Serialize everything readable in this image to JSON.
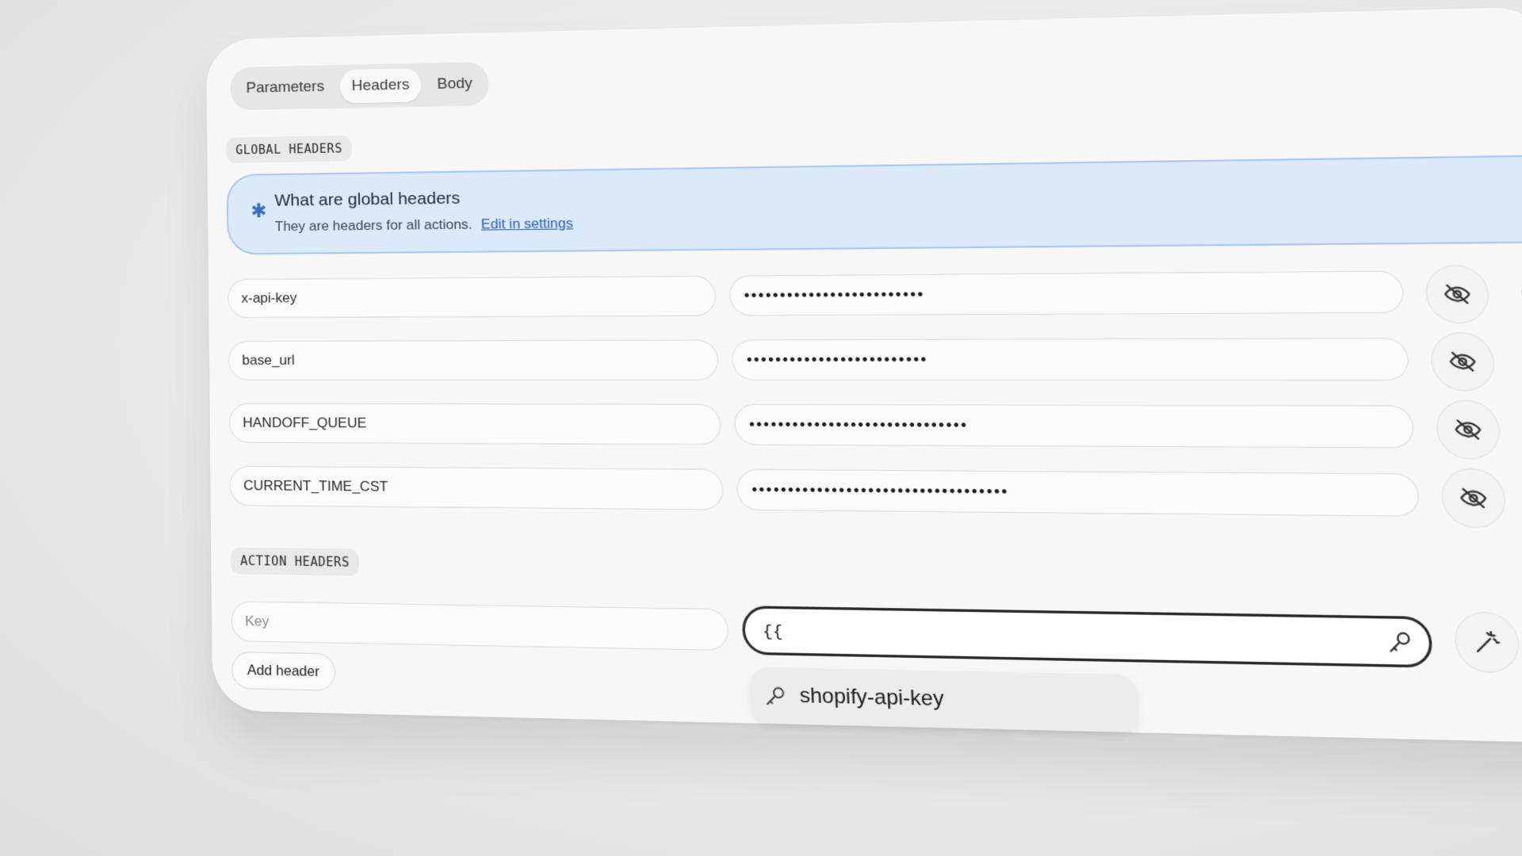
{
  "tabs": [
    {
      "label": "Parameters",
      "active": false
    },
    {
      "label": "Headers",
      "active": true
    },
    {
      "label": "Body",
      "active": false
    }
  ],
  "global_headers": {
    "section_label": "GLOBAL HEADERS",
    "info": {
      "icon": "asterisk-icon",
      "title": "What are global headers",
      "text": "They are headers for all actions.",
      "link": "Edit in settings"
    },
    "rows": [
      {
        "key": "x-api-key",
        "value": "•••••••••••••••••••••••••"
      },
      {
        "key": "base_url",
        "value": "•••••••••••••••••••••••••"
      },
      {
        "key": "HANDOFF_QUEUE",
        "value": "••••••••••••••••••••••••••••••"
      },
      {
        "key": "CURRENT_TIME_CST",
        "value": "•••••••••••••••••••••••••••••••••••"
      }
    ]
  },
  "action_headers": {
    "section_label": "ACTION HEADERS",
    "key_placeholder": "Key",
    "value_text": "{{",
    "add_button": "Add header",
    "suggestion": "shopify-api-key"
  },
  "colors": {
    "info_bg": "#dbe9fb",
    "info_border": "#a9c7f0",
    "link": "#2c5eb8",
    "danger": "#e05c6c"
  }
}
